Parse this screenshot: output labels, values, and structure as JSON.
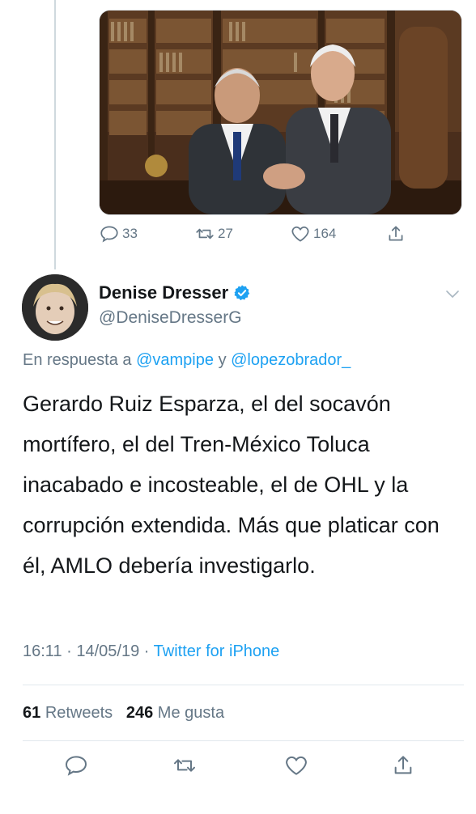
{
  "previous_tweet": {
    "actions": {
      "reply_count": "33",
      "retweet_count": "27",
      "like_count": "164"
    }
  },
  "tweet": {
    "author_name": "Denise Dresser",
    "author_handle": "@DeniseDresserG",
    "reply_prefix": "En respuesta a",
    "reply_mention_1": "@vampipe",
    "reply_joiner": "y",
    "reply_mention_2": "@lopezobrador_",
    "text": "Gerardo Ruiz Esparza, el del socavón mortífero, el del Tren-México Toluca inacabado e incosteable, el de OHL y la corrupción extendida. Más que platicar con él, AMLO debería investigarlo.",
    "time": "16:11",
    "date": "14/05/19",
    "separator": "·",
    "source": "Twitter for iPhone",
    "retweets_count": "61",
    "retweets_label": "Retweets",
    "likes_count": "246",
    "likes_label": "Me gusta"
  },
  "colors": {
    "link_blue": "#1da1f2",
    "secondary_gray": "#657786",
    "divider": "#e1e8ed"
  },
  "icons": [
    "reply-icon",
    "retweet-icon",
    "like-icon",
    "share-icon",
    "verified-badge-icon",
    "chevron-down-icon"
  ]
}
